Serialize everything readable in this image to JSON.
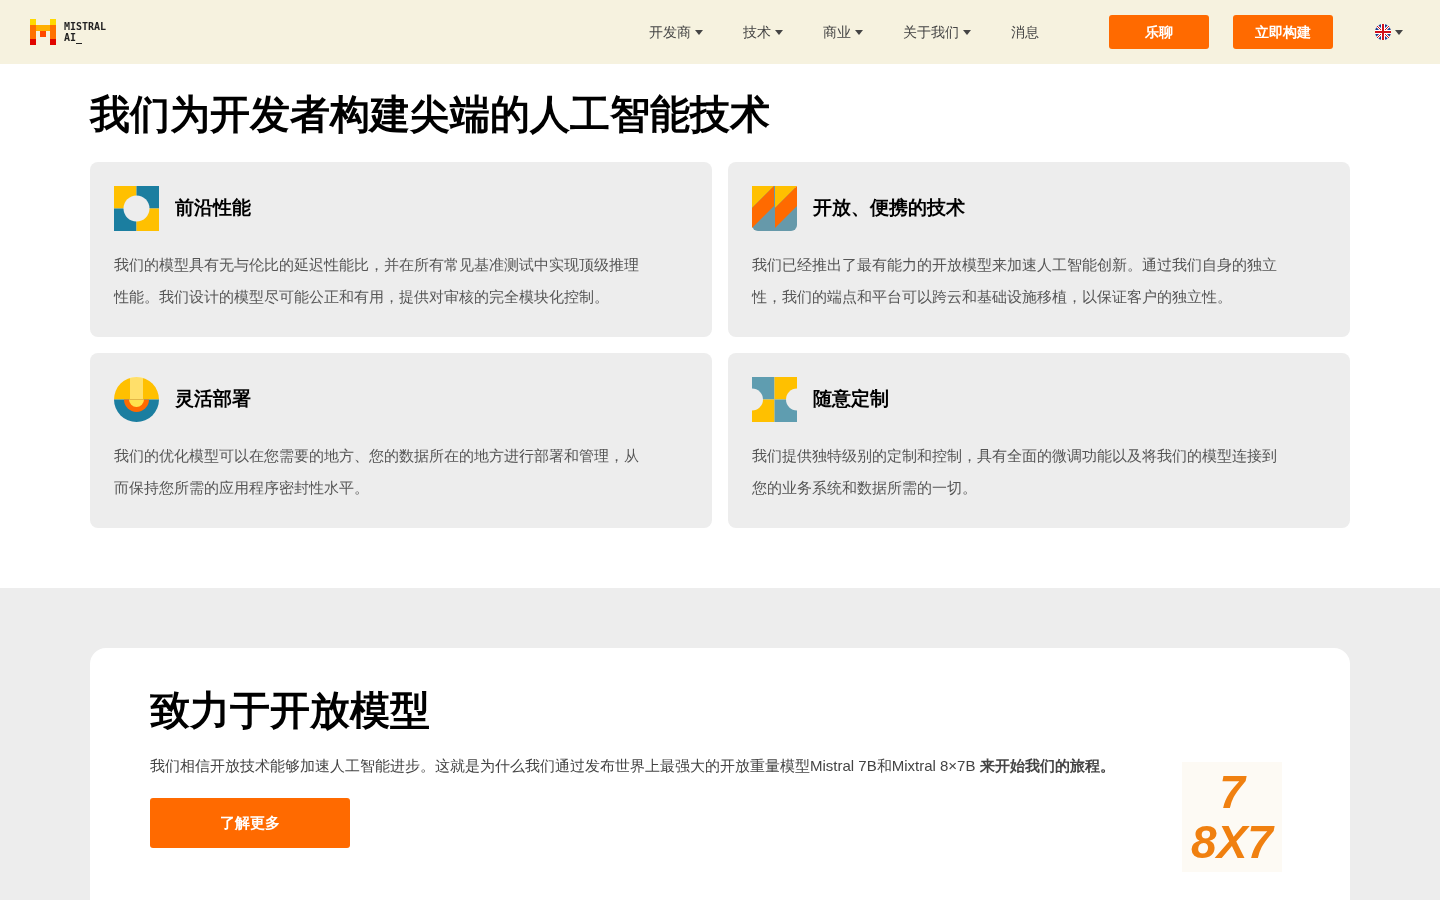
{
  "header": {
    "logo_text": [
      "MISTRAL",
      "AI_"
    ],
    "nav": [
      {
        "label": "开发商",
        "dropdown": true
      },
      {
        "label": "技术",
        "dropdown": true
      },
      {
        "label": "商业",
        "dropdown": true
      },
      {
        "label": "关于我们",
        "dropdown": true
      },
      {
        "label": "消息",
        "dropdown": false
      }
    ],
    "buttons": [
      "乐聊",
      "立即构建"
    ]
  },
  "hero": {
    "title": "我们为开发者构建尖端的人工智能技术",
    "features": [
      {
        "kind": "ring",
        "title": "前沿性能",
        "text": "我们的模型具有无与伦比的延迟性能比，并在所有常见基准测试中实现顶级推理性能。我们设计的模型尽可能公正和有用，提供对审核的完全模块化控制。"
      },
      {
        "kind": "stripes",
        "title": "开放、便携的技术",
        "text": "我们已经推出了最有能力的开放模型来加速人工智能创新。通过我们自身的独立性，我们的端点和平台可以跨云和基础设施移植，以保证客户的独立性。"
      },
      {
        "kind": "sun",
        "title": "灵活部署",
        "text": "我们的优化模型可以在您需要的地方、您的数据所在的地方进行部署和管理，从而保持您所需的应用程序密封性水平。"
      },
      {
        "kind": "halves",
        "title": "随意定制",
        "text": "我们提供独特级别的定制和控制，具有全面的微调功能以及将我们的模型连接到您的业务系统和数据所需的一切。"
      }
    ]
  },
  "open_models": {
    "title": "致力于开放模型",
    "text": "我们相信开放技术能够加速人工智能进步。这就是为什么我们通过发布世界上最强大的开放重量模型Mistral 7B和Mixtral 8×7B **来开始我们的旅程。**",
    "button": "了解更多",
    "graphic_lines": [
      "7",
      "8X7"
    ]
  }
}
